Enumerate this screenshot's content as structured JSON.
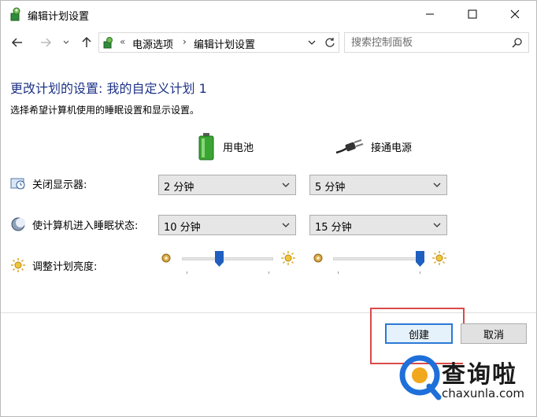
{
  "window": {
    "title": "编辑计划设置",
    "icon": "power-plan-icon"
  },
  "nav": {
    "breadcrumb_sep": "«",
    "crumb_1": "电源选项",
    "crumb_arrow": "›",
    "crumb_2": "编辑计划设置",
    "search_placeholder": "搜索控制面板"
  },
  "content": {
    "heading": "更改计划的设置: 我的自定义计划 1",
    "subtext": "选择希望计算机使用的睡眠设置和显示设置。",
    "columns": {
      "battery": "用电池",
      "ac": "接通电源"
    },
    "rows": {
      "display": {
        "label": "关闭显示器:",
        "battery_value": "2 分钟",
        "ac_value": "5 分钟"
      },
      "sleep": {
        "label": "使计算机进入睡眠状态:",
        "battery_value": "10 分钟",
        "ac_value": "15 分钟"
      },
      "brightness": {
        "label": "调整计划亮度:",
        "battery_level_pct": 40,
        "ac_level_pct": 100
      }
    }
  },
  "buttons": {
    "create": "创建",
    "cancel": "取消"
  },
  "watermark": {
    "text": "查询啦",
    "url": "chaxunla.com"
  },
  "colors": {
    "heading": "#1e3287",
    "accent": "#2b79d6",
    "slider_thumb": "#1f5fbf",
    "highlight": "#d94a4a",
    "watermark_blue": "#1e6fd9"
  }
}
